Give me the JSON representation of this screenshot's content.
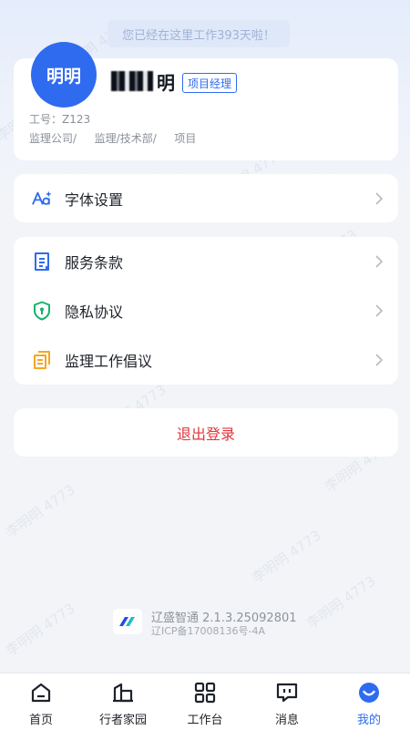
{
  "banner": {
    "text": "您已经在这里工作393天啦！"
  },
  "profile": {
    "avatar_text": "明明",
    "name_visible": "明",
    "role_badge": "项目经理",
    "employee_id": "工号：Z123",
    "org_path": "监理公司/ 　 监理/技术部/ 　 项目"
  },
  "font_settings": {
    "icon": "font-size-icon",
    "label": "字体设置"
  },
  "menu": {
    "items": [
      {
        "icon": "document-icon",
        "label": "服务条款"
      },
      {
        "icon": "shield-icon",
        "label": "隐私协议"
      },
      {
        "icon": "copy-document-icon",
        "label": "监理工作倡议"
      }
    ]
  },
  "logout": {
    "label": "退出登录"
  },
  "footer": {
    "app_version": "辽盛智通 2.1.3.25092801",
    "icp": "辽ICP备17008136号-4A"
  },
  "tabbar": {
    "tabs": [
      {
        "icon": "home-icon",
        "label": "首页"
      },
      {
        "icon": "building-icon",
        "label": "行者家园"
      },
      {
        "icon": "grid-icon",
        "label": "工作台"
      },
      {
        "icon": "message-icon",
        "label": "消息"
      },
      {
        "icon": "smile-icon",
        "label": "我的"
      }
    ],
    "active_label": "我的"
  },
  "watermark": {
    "text": "李明明 4773"
  },
  "colors": {
    "accent": "#2f6bef",
    "danger": "#e0353b",
    "background": "#f2f4f8"
  }
}
